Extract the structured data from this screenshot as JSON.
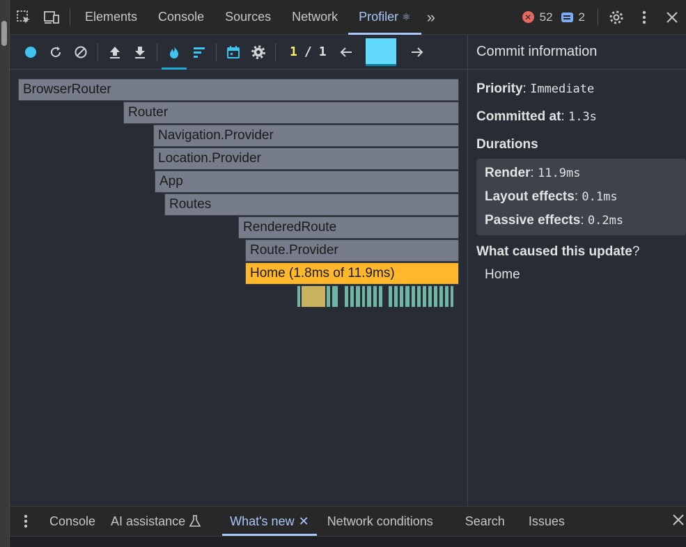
{
  "devtools_tabs": {
    "elements": "Elements",
    "console": "Console",
    "sources": "Sources",
    "network": "Network",
    "profiler": "Profiler",
    "profiler_glyph": "⚛",
    "overflow": "»"
  },
  "badges": {
    "errors": "52",
    "messages": "2"
  },
  "toolbar": {
    "commit_current": "1",
    "commit_separator": "/",
    "commit_total": "1"
  },
  "flame": {
    "rows": [
      {
        "label": "BrowserRouter"
      },
      {
        "label": "Router"
      },
      {
        "label": "Navigation.Provider"
      },
      {
        "label": "Location.Provider"
      },
      {
        "label": "App"
      },
      {
        "label": "Routes"
      },
      {
        "label": "RenderedRoute"
      },
      {
        "label": "Route.Provider"
      },
      {
        "label": "Home (1.8ms of 11.9ms)"
      }
    ]
  },
  "commit_info": {
    "title": "Commit information",
    "priority_label": "Priority",
    "priority_value": "Immediate",
    "committed_label": "Committed at",
    "committed_value": "1.3s",
    "durations_label": "Durations",
    "render_label": "Render",
    "render_value": "11.9ms",
    "layout_label": "Layout effects",
    "layout_value": "0.1ms",
    "passive_label": "Passive effects",
    "passive_value": "0.2ms",
    "cause_label": "What caused this update",
    "cause_value": "Home"
  },
  "drawer_tabs": {
    "console": "Console",
    "ai": "AI assistance",
    "whats_new": "What's new",
    "network_conditions": "Network conditions",
    "search": "Search",
    "issues": "Issues"
  },
  "colors": {
    "accent": "#a8c7fa",
    "react_blue": "#61dafb",
    "flame_gray": "#767c89",
    "flame_highlight": "#ffb72c"
  }
}
